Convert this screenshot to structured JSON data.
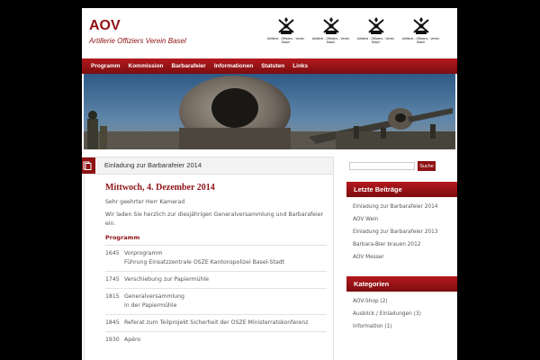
{
  "site": {
    "title": "AOV",
    "tagline": "Artillerie Offiziers Verein Basel"
  },
  "logos": [
    {
      "icon": "crossed-cannons-icon",
      "text": "Artillerie - Offiziers - Verein Basel"
    },
    {
      "icon": "crossed-cannons-icon",
      "text": "Artillerie - Offiziers - Verein Basel"
    },
    {
      "icon": "crossed-cannons-icon",
      "text": "Artillerie - Offiziers - Verein Basel"
    },
    {
      "icon": "crossed-cannons-icon",
      "text": "Artillerie - Offiziers - Verein Basel"
    }
  ],
  "nav": {
    "items": [
      "Programm",
      "Kommission",
      "Barbarafeier",
      "Informationen",
      "Statuten",
      "Links"
    ]
  },
  "article": {
    "header_title": "Einladung zur Barbarafeier 2014",
    "post_title": "Mittwoch, 4. Dezember 2014",
    "greeting": "Sehr geehrter Herr Kamerad",
    "intro": "Wir laden Sie herzlich zur diesjährigen Generalversammlung und Barbarafeier ein.",
    "programm_label": "Programm",
    "programm": [
      {
        "time": "1645",
        "desc": "Vorprogramm",
        "desc2": "Führung Einsatzzentrale OSZE Kantonspolizei Basel-Stadt"
      },
      {
        "time": "1745",
        "desc": "Verschiebung zur Papiermühle",
        "desc2": ""
      },
      {
        "time": "1815",
        "desc": "Generalversammlung",
        "desc2": "in der Papiermühle"
      },
      {
        "time": "1845",
        "desc": "Referat zum Teilprojekt Sicherheit der OSZE Ministerratskonferenz",
        "desc2": ""
      },
      {
        "time": "1930",
        "desc": "Apéro",
        "desc2": ""
      }
    ]
  },
  "sidebar": {
    "search_placeholder": "",
    "search_button": "Suche",
    "recent_title": "Letzte Beiträge",
    "recent_items": [
      "Einladung zur Barbarafeier 2014",
      "AOV Wein",
      "Einladung zur Barbarafeier 2013",
      "Barbara-Bier brauen 2012",
      "AOV Messer"
    ],
    "categories_title": "Kategorien",
    "categories": [
      "AOV-Shop (2)",
      "Ausblick / Einladungen (3)",
      "Information (1)"
    ]
  },
  "colors": {
    "accent": "#8f1215",
    "background": "#000000"
  }
}
